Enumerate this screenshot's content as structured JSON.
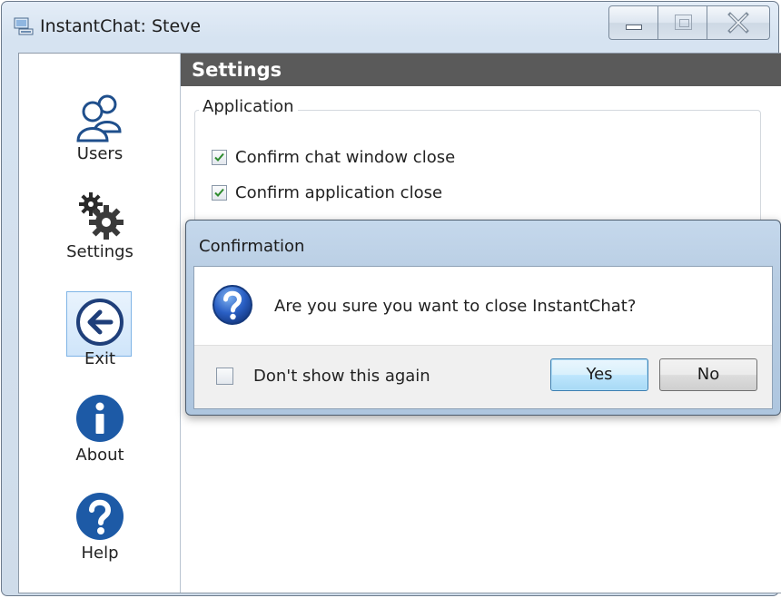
{
  "window": {
    "title": "InstantChat: Steve"
  },
  "sidebar": {
    "items": [
      {
        "label": "Users",
        "icon": "users-icon"
      },
      {
        "label": "Settings",
        "icon": "gears-icon"
      },
      {
        "label": "Exit",
        "icon": "back-arrow-icon",
        "selected": true
      },
      {
        "label": "About",
        "icon": "info-icon"
      },
      {
        "label": "Help",
        "icon": "help-icon"
      }
    ]
  },
  "settings": {
    "header": "Settings",
    "group_title": "Application",
    "options": [
      {
        "label": "Confirm chat window close",
        "checked": true
      },
      {
        "label": "Confirm application close",
        "checked": true
      }
    ]
  },
  "dialog": {
    "title": "Confirmation",
    "message": "Are you sure you want to close InstantChat?",
    "dont_show_label": "Don't show this again",
    "dont_show_checked": false,
    "yes_label": "Yes",
    "no_label": "No"
  },
  "colors": {
    "accent": "#2a6fd1",
    "header_bg": "#5a5a5a",
    "checkmark": "#2e8b2e"
  }
}
